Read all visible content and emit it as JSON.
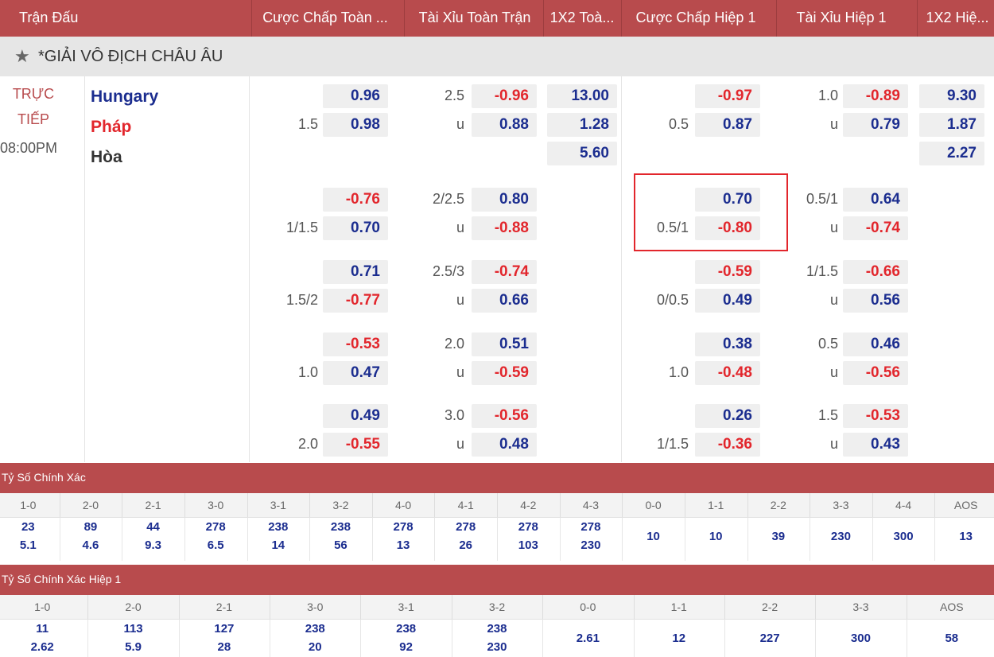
{
  "header": {
    "columns": [
      "Trận Đấu",
      "Cược Chấp Toàn ...",
      "Tài Xỉu Toàn Trận",
      "1X2 Toà...",
      "Cược Chấp Hiệp 1",
      "Tài Xỉu Hiệp 1",
      "1X2 Hiệ..."
    ]
  },
  "league": {
    "name": "*GIẢI VÔ ĐỊCH CHÂU ÂU",
    "star_icon": "★"
  },
  "match": {
    "status": [
      "TRỰC",
      "TIẾP"
    ],
    "time": "08:00PM",
    "home": "Hungary",
    "away": "Pháp",
    "draw": "Hòa",
    "home_color": "#1b2d8f",
    "away_color": "#e2262c"
  },
  "odds_rows": [
    {
      "ft_hdp": "1.5",
      "ft_hdp_top": "0.96",
      "ft_hdp_bot": "0.98",
      "ft_ou": "2.5",
      "ft_ou_u": "u",
      "ft_ou_top": "-0.96",
      "ft_ou_bot": "0.88",
      "ft_1x2": [
        "13.00",
        "1.28",
        "5.60"
      ],
      "h1_hdp": "0.5",
      "h1_hdp_top": "-0.97",
      "h1_hdp_bot": "0.87",
      "h1_ou": "1.0",
      "h1_ou_u": "u",
      "h1_ou_top": "-0.89",
      "h1_ou_bot": "0.79",
      "h1_1x2": [
        "9.30",
        "1.87",
        "2.27"
      ]
    },
    {
      "ft_hdp": "1/1.5",
      "ft_hdp_top": "-0.76",
      "ft_hdp_bot": "0.70",
      "ft_ou": "2/2.5",
      "ft_ou_u": "u",
      "ft_ou_top": "0.80",
      "ft_ou_bot": "-0.88",
      "h1_hdp": "0.5/1",
      "h1_hdp_top": "0.70",
      "h1_hdp_bot": "-0.80",
      "h1_ou": "0.5/1",
      "h1_ou_u": "u",
      "h1_ou_top": "0.64",
      "h1_ou_bot": "-0.74"
    },
    {
      "ft_hdp": "1.5/2",
      "ft_hdp_top": "0.71",
      "ft_hdp_bot": "-0.77",
      "ft_ou": "2.5/3",
      "ft_ou_u": "u",
      "ft_ou_top": "-0.74",
      "ft_ou_bot": "0.66",
      "h1_hdp": "0/0.5",
      "h1_hdp_top": "-0.59",
      "h1_hdp_bot": "0.49",
      "h1_ou": "1/1.5",
      "h1_ou_u": "u",
      "h1_ou_top": "-0.66",
      "h1_ou_bot": "0.56"
    },
    {
      "ft_hdp": "1.0",
      "ft_hdp_top": "-0.53",
      "ft_hdp_bot": "0.47",
      "ft_ou": "2.0",
      "ft_ou_u": "u",
      "ft_ou_top": "0.51",
      "ft_ou_bot": "-0.59",
      "h1_hdp": "1.0",
      "h1_hdp_top": "0.38",
      "h1_hdp_bot": "-0.48",
      "h1_ou": "0.5",
      "h1_ou_u": "u",
      "h1_ou_top": "0.46",
      "h1_ou_bot": "-0.56"
    },
    {
      "ft_hdp": "2.0",
      "ft_hdp_top": "0.49",
      "ft_hdp_bot": "-0.55",
      "ft_ou": "3.0",
      "ft_ou_u": "u",
      "ft_ou_top": "-0.56",
      "ft_ou_bot": "0.48",
      "h1_hdp": "1/1.5",
      "h1_hdp_top": "0.26",
      "h1_hdp_bot": "-0.36",
      "h1_ou": "1.5",
      "h1_ou_u": "u",
      "h1_ou_top": "-0.53",
      "h1_ou_bot": "0.43"
    }
  ],
  "correct_score": {
    "title": "Tỷ Số Chính Xác",
    "headers": [
      "1-0",
      "2-0",
      "2-1",
      "3-0",
      "3-1",
      "3-2",
      "4-0",
      "4-1",
      "4-2",
      "4-3",
      "0-0",
      "1-1",
      "2-2",
      "3-3",
      "4-4",
      "AOS"
    ],
    "top": [
      "23",
      "89",
      "44",
      "278",
      "238",
      "238",
      "278",
      "278",
      "278",
      "278",
      "10",
      "10",
      "39",
      "230",
      "300",
      "13"
    ],
    "bottom": [
      "5.1",
      "4.6",
      "9.3",
      "6.5",
      "14",
      "56",
      "13",
      "26",
      "103",
      "230",
      "",
      "",
      "",
      "",
      "",
      ""
    ]
  },
  "correct_score_h1": {
    "title": "Tỷ Số Chính Xác Hiệp 1",
    "headers": [
      "1-0",
      "2-0",
      "2-1",
      "3-0",
      "3-1",
      "3-2",
      "0-0",
      "1-1",
      "2-2",
      "3-3",
      "AOS"
    ],
    "top": [
      "11",
      "113",
      "127",
      "238",
      "238",
      "238",
      "2.61",
      "12",
      "227",
      "300",
      "58"
    ],
    "bottom": [
      "2.62",
      "5.9",
      "28",
      "20",
      "92",
      "230",
      "",
      "",
      "",
      "",
      ""
    ]
  }
}
